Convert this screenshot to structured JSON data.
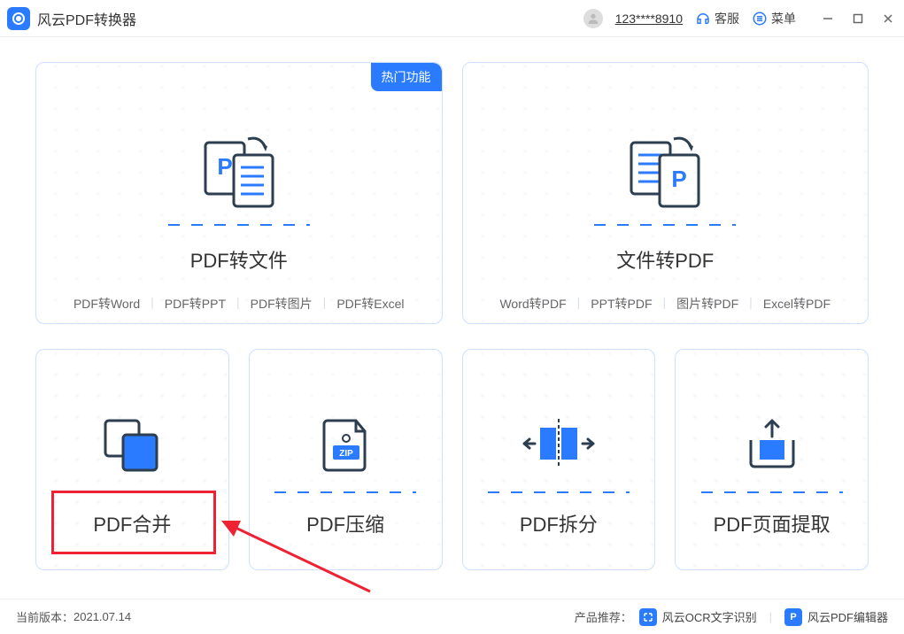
{
  "app": {
    "title": "风云PDF转换器"
  },
  "titlebar": {
    "username": "123****8910",
    "support_label": "客服",
    "menu_label": "菜单"
  },
  "cards": {
    "hot_badge": "热门功能",
    "pdf_to_file": {
      "title": "PDF转文件",
      "subs": [
        "PDF转Word",
        "PDF转PPT",
        "PDF转图片",
        "PDF转Excel"
      ]
    },
    "file_to_pdf": {
      "title": "文件转PDF",
      "subs": [
        "Word转PDF",
        "PPT转PDF",
        "图片转PDF",
        "Excel转PDF"
      ]
    },
    "merge": {
      "title": "PDF合并"
    },
    "compress": {
      "title": "PDF压缩"
    },
    "split": {
      "title": "PDF拆分"
    },
    "extract": {
      "title": "PDF页面提取"
    }
  },
  "footer": {
    "version_label": "当前版本：",
    "version": "2021.07.14",
    "recommend_label": "产品推荐：",
    "ocr": "风云OCR文字识别",
    "editor": "风云PDF编辑器"
  },
  "colors": {
    "primary": "#2a7bff",
    "highlight": "#e23"
  }
}
